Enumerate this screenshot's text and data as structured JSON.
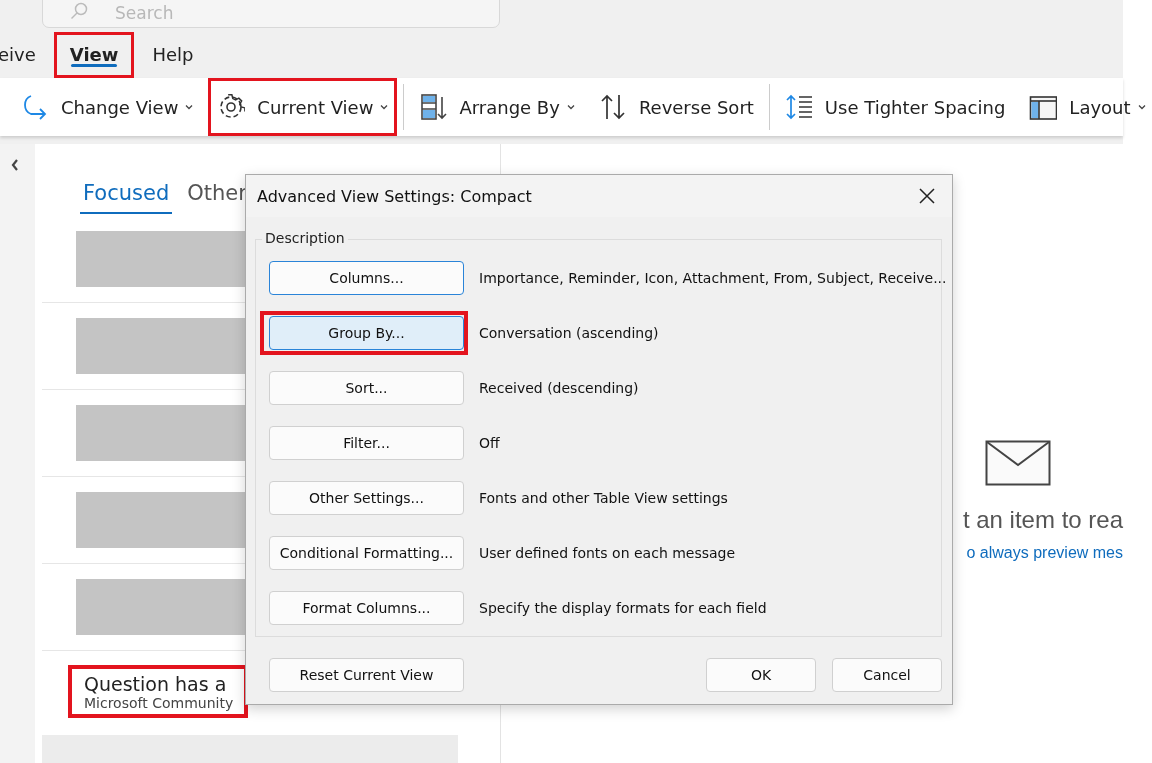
{
  "search": {
    "placeholder": "Search"
  },
  "menu_tabs": [
    {
      "label": "eive",
      "selected": false,
      "highlighted": false
    },
    {
      "label": "View",
      "selected": true,
      "highlighted": true
    },
    {
      "label": "Help",
      "selected": false,
      "highlighted": false
    }
  ],
  "ribbon": [
    {
      "kind": "button",
      "label": "Change View",
      "dropdown": true,
      "highlighted": false
    },
    {
      "kind": "button",
      "label": "Current View",
      "dropdown": true,
      "highlighted": true
    },
    {
      "kind": "separator"
    },
    {
      "kind": "button",
      "label": "Arrange By",
      "dropdown": true,
      "highlighted": false
    },
    {
      "kind": "button",
      "label": "Reverse Sort",
      "dropdown": false,
      "highlighted": false
    },
    {
      "kind": "separator"
    },
    {
      "kind": "button",
      "label": "Use Tighter Spacing",
      "dropdown": false,
      "highlighted": false
    },
    {
      "kind": "button",
      "label": "Layout",
      "dropdown": true,
      "highlighted": false
    }
  ],
  "message_list": {
    "tabs": [
      {
        "label": "Focused",
        "selected": true
      },
      {
        "label": "Other",
        "selected": false
      }
    ],
    "rows": [
      {
        "kind": "redacted"
      },
      {
        "kind": "redacted"
      },
      {
        "kind": "redacted"
      },
      {
        "kind": "redacted"
      },
      {
        "kind": "redacted"
      },
      {
        "kind": "message",
        "subject": "Question has a",
        "sender": "Microsoft Community",
        "highlighted": true
      }
    ]
  },
  "reading_pane": {
    "message": "t an item to rea",
    "link": "o always preview mes"
  },
  "dialog": {
    "title": "Advanced View Settings: Compact",
    "group_label": "Description",
    "rows": [
      {
        "button": "Columns...",
        "description": "Importance, Reminder, Icon, Attachment, From, Subject, Receive...",
        "focused": true,
        "hovered": false,
        "highlighted": false
      },
      {
        "button": "Group By...",
        "description": "Conversation (ascending)",
        "focused": false,
        "hovered": true,
        "highlighted": true
      },
      {
        "button": "Sort...",
        "description": "Received (descending)",
        "focused": false,
        "hovered": false,
        "highlighted": false
      },
      {
        "button": "Filter...",
        "description": "Off",
        "focused": false,
        "hovered": false,
        "highlighted": false
      },
      {
        "button": "Other Settings...",
        "description": "Fonts and other Table View settings",
        "focused": false,
        "hovered": false,
        "highlighted": false
      },
      {
        "button": "Conditional Formatting...",
        "description": "User defined fonts on each message",
        "focused": false,
        "hovered": false,
        "highlighted": false
      },
      {
        "button": "Format Columns...",
        "description": "Specify the display formats for each field",
        "focused": false,
        "hovered": false,
        "highlighted": false
      }
    ],
    "footer_buttons": [
      {
        "kind": "left",
        "label": "Reset Current View"
      },
      {
        "kind": "right",
        "label": "OK"
      },
      {
        "kind": "right",
        "label": "Cancel"
      }
    ]
  }
}
